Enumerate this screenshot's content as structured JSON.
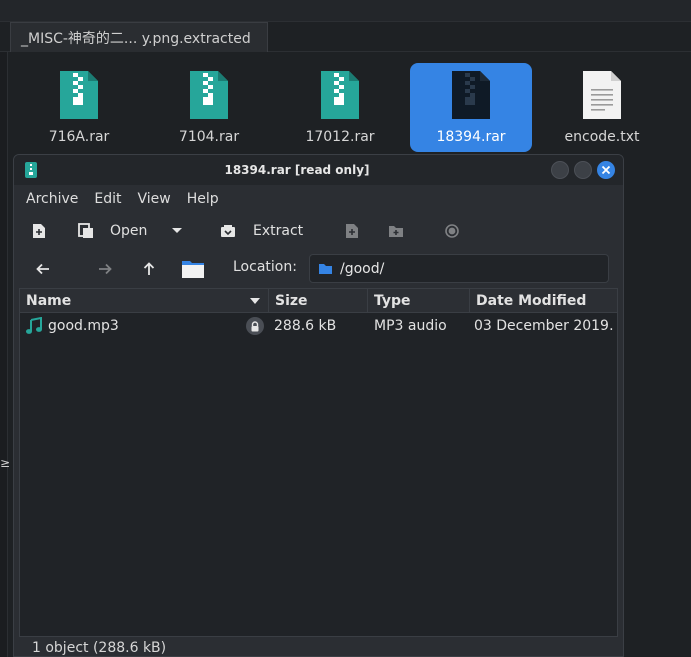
{
  "background": {
    "tab_label": "_MISC-神奇的二... y.png.extracted",
    "files": [
      {
        "name": "716A.rar",
        "icon": "archive-icon",
        "selected": false
      },
      {
        "name": "7104.rar",
        "icon": "archive-icon",
        "selected": false
      },
      {
        "name": "17012.rar",
        "icon": "archive-icon",
        "selected": false
      },
      {
        "name": "18394.rar",
        "icon": "archive-icon",
        "selected": true
      },
      {
        "name": "encode.txt",
        "icon": "text-file-icon",
        "selected": false
      }
    ]
  },
  "window": {
    "title": "18394.rar [read only]",
    "menu": [
      "Archive",
      "Edit",
      "View",
      "Help"
    ],
    "toolbar": {
      "open": "Open",
      "extract": "Extract"
    },
    "location_label": "Location:",
    "location_value": "/good/",
    "columns": [
      "Name",
      "Size",
      "Type",
      "Date Modified"
    ],
    "rows": [
      {
        "name": "good.mp3",
        "size": "288.6 kB",
        "type": "MP3 audio",
        "date": "03 December 2019…",
        "locked": true
      }
    ],
    "status": "1 object (288.6 kB)"
  },
  "colors": {
    "accent": "#3584e4",
    "archive": "#26a69a"
  }
}
